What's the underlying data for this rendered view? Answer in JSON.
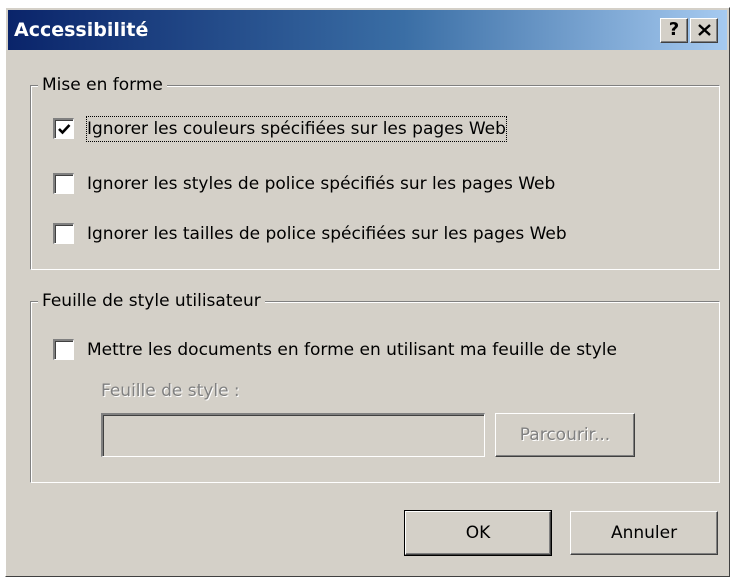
{
  "window": {
    "title": "Accessibilité",
    "help_button": "?"
  },
  "formatting_group": {
    "legend": "Mise en forme",
    "options": [
      {
        "label": "Ignorer les couleurs spécifiées sur les pages Web",
        "checked": true
      },
      {
        "label": "Ignorer les styles de police spécifiés sur les pages Web",
        "checked": false
      },
      {
        "label": "Ignorer les tailles de police spécifiées sur les pages Web",
        "checked": false
      }
    ]
  },
  "user_stylesheet_group": {
    "legend": "Feuille de style utilisateur",
    "option": {
      "label": "Mettre les documents en forme en utilisant ma feuille de style",
      "checked": false
    },
    "stylesheet_label": "Feuille de style :",
    "stylesheet_value": "",
    "browse_button": "Parcourir..."
  },
  "buttons": {
    "ok": "OK",
    "cancel": "Annuler"
  },
  "colors": {
    "face": "#d4d0c8",
    "title_start": "#0a246a",
    "title_end": "#a6caf0",
    "disabled_text": "#808080"
  },
  "icons": {
    "help": "question-mark",
    "close": "x-mark",
    "check": "check-mark"
  }
}
